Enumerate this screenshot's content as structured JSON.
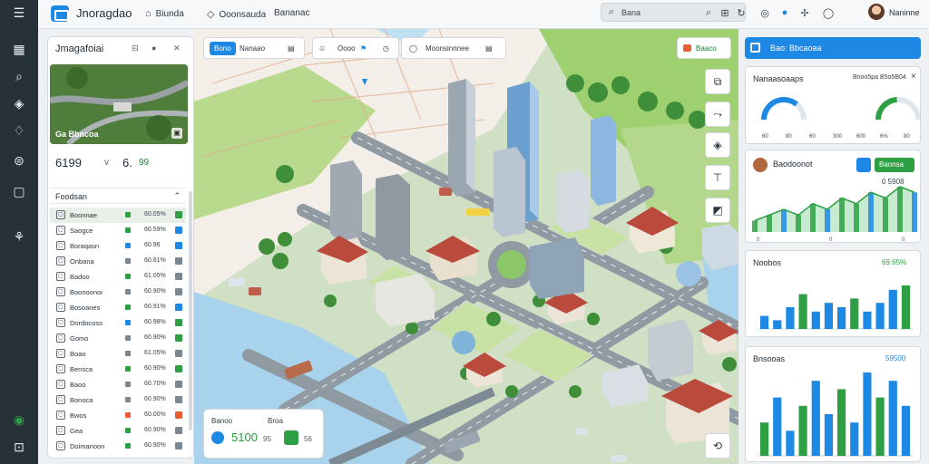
{
  "app": {
    "title": "Jnoragdao"
  },
  "nav": [
    {
      "icon": "home-icon",
      "label": "Biunda"
    },
    {
      "icon": "pin-icon",
      "label": "Ooonsauda"
    },
    {
      "icon": "",
      "label": "Bananac"
    }
  ],
  "search": {
    "label": "Bana",
    "placeholder": ""
  },
  "top_icons": [
    "search-icon",
    "grid-icon",
    "refresh-icon",
    "settings-icon",
    "status-icon",
    "pin-icon",
    "bell-icon"
  ],
  "user": {
    "name": "Naninne"
  },
  "sidebar": {
    "icons": [
      "layers-icon",
      "search-icon",
      "tag-icon",
      "bell-icon",
      "car-icon",
      "square-icon",
      "tree-icon",
      "status-dot-icon",
      "person-icon"
    ]
  },
  "left_panel": {
    "title": "Jmagafoiai",
    "thumb_label": "Ga Bbncoa",
    "stat_a": "6199",
    "stat_sep": "v",
    "stat_b": "6.",
    "stat_c": "99",
    "section": "Foodsan",
    "rows": [
      {
        "name": "Boonnae",
        "pct": "60.05%",
        "dot": "#2ea043",
        "tag": "#2ea043",
        "selected": true
      },
      {
        "name": "Saogce",
        "pct": "60.59%",
        "dot": "#2ea043",
        "tag": "#1e88e5"
      },
      {
        "name": "Boraqasn",
        "pct": "60.96",
        "dot": "#1e88e5",
        "tag": "#1e88e5"
      },
      {
        "name": "Onbana",
        "pct": "60.61%",
        "dot": "#7a8790",
        "tag": "#7a8790"
      },
      {
        "name": "Badoo",
        "pct": "61.05%",
        "dot": "#2ea043",
        "tag": "#7a8790"
      },
      {
        "name": "Boonoonoi",
        "pct": "60.90%",
        "dot": "#7a8790",
        "tag": "#7a8790"
      },
      {
        "name": "Bosoanes",
        "pct": "60.91%",
        "dot": "#2ea043",
        "tag": "#1e88e5"
      },
      {
        "name": "Dordocoss",
        "pct": "60.98%",
        "dot": "#1e88e5",
        "tag": "#2ea043"
      },
      {
        "name": "Gomo",
        "pct": "60.90%",
        "dot": "#7a8790",
        "tag": "#2ea043"
      },
      {
        "name": "Boao",
        "pct": "61.05%",
        "dot": "#7a8790",
        "tag": "#7a8790"
      },
      {
        "name": "Bensca",
        "pct": "60.90%",
        "dot": "#2ea043",
        "tag": "#2ea043"
      },
      {
        "name": "Baoo",
        "pct": "60.70%",
        "dot": "#7a8790",
        "tag": "#7a8790"
      },
      {
        "name": "Bonoca",
        "pct": "60.90%",
        "dot": "#7a8790",
        "tag": "#7a8790"
      },
      {
        "name": "Bwos",
        "pct": "60.00%",
        "dot": "#e85d33",
        "tag": "#e85d33"
      },
      {
        "name": "Gea",
        "pct": "60.90%",
        "dot": "#2ea043",
        "tag": "#7a8790"
      },
      {
        "name": "Doimanoon",
        "pct": "60.90%",
        "dot": "#2ea043",
        "tag": "#7a8790"
      }
    ]
  },
  "map_toolbar": {
    "b1": "Bono",
    "b2": "Nanaao",
    "b3": "Oooo",
    "b4": "Moonsinnnee"
  },
  "cta": {
    "label": "Baaco"
  },
  "bottom_card": {
    "l1": "Banoo",
    "l2": "Broa",
    "big": "5100",
    "small": "95",
    "tail": "56"
  },
  "right_panel": {
    "header": "Bao: Bbcaoaa",
    "card1": {
      "title": "Nanaasoaaps",
      "values": "Bnoo5pa   B5o5B04",
      "close": "×",
      "gauges": [
        0.72,
        0.48
      ],
      "ticks": [
        "60",
        "80",
        "60",
        "300",
        "600",
        "6%",
        "80"
      ]
    },
    "card2": {
      "title": "Baodoonot",
      "badge": "Baonsa",
      "value": "0 5908",
      "ticks": [
        "0",
        "0",
        "0"
      ]
    },
    "card3": {
      "title": "Noobos",
      "value": "69.65%"
    },
    "card4": {
      "title": "Bnsooas",
      "value": "59500"
    }
  },
  "chart_data": [
    {
      "type": "area",
      "series": [
        {
          "values": [
            2,
            3,
            4,
            3,
            5,
            4,
            6,
            5,
            7,
            6,
            8,
            7
          ]
        }
      ]
    },
    {
      "type": "bar",
      "series": [
        {
          "values": [
            3,
            2,
            5,
            8,
            4,
            6,
            5,
            7,
            4,
            6,
            9,
            10
          ]
        }
      ]
    },
    {
      "type": "bar",
      "series": [
        {
          "values": [
            4,
            7,
            3,
            6,
            9,
            5,
            8,
            4,
            10,
            7,
            9,
            6
          ]
        }
      ]
    }
  ],
  "colors": {
    "accent": "#1e88e5",
    "green": "#2ea043",
    "rail": "#263238",
    "water": "#a9d3ec"
  }
}
